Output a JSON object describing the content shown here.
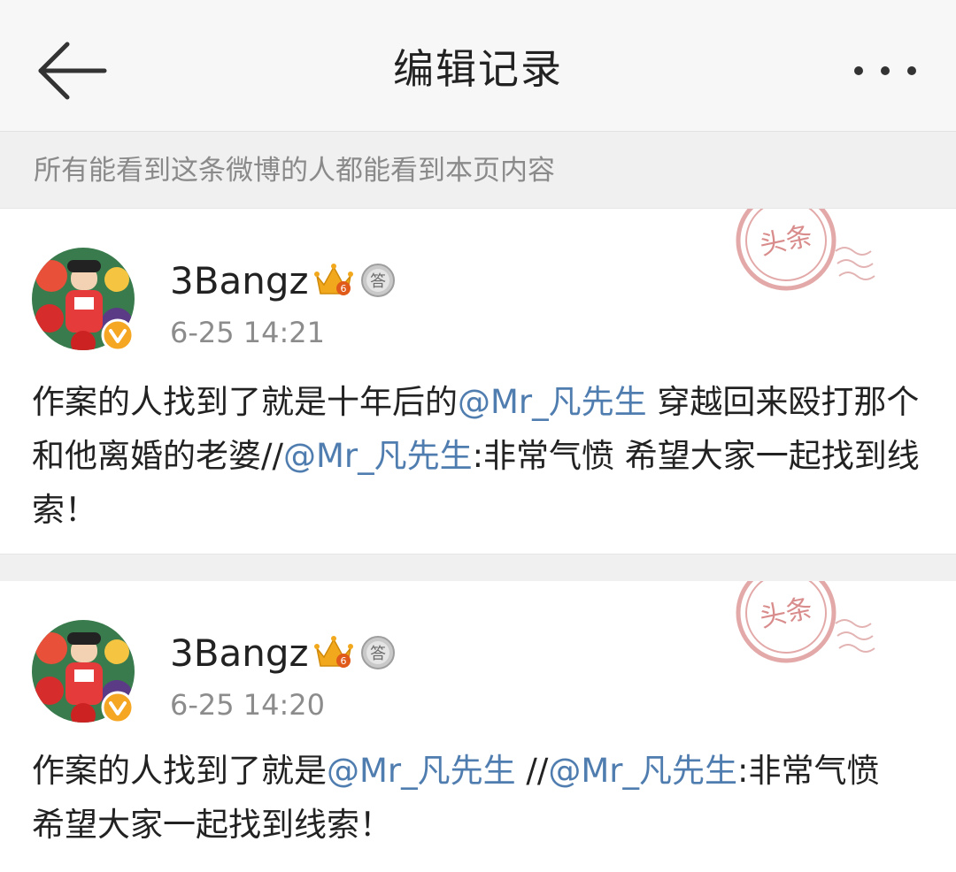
{
  "nav": {
    "title": "编辑记录",
    "back_icon": "arrow-left-icon",
    "more_icon": "more-dots-icon"
  },
  "notice": {
    "text": "所有能看到这条微博的人都能看到本页内容"
  },
  "posts": [
    {
      "username": "3Bangz",
      "timestamp": "6-25 14:21",
      "stamp_text": "头条",
      "segments": [
        {
          "type": "text",
          "text": "作案的人找到了就是十年后的"
        },
        {
          "type": "mention",
          "text": "@Mr_凡先生"
        },
        {
          "type": "text",
          "text": " 穿越回来殴打那个和他离婚的老婆//"
        },
        {
          "type": "mention",
          "text": "@Mr_凡先生"
        },
        {
          "type": "text",
          "text": ":非常气愤 希望大家一起找到线索！"
        }
      ]
    },
    {
      "username": "3Bangz",
      "timestamp": "6-25 14:20",
      "stamp_text": "头条",
      "segments": [
        {
          "type": "text",
          "text": "作案的人找到了就是"
        },
        {
          "type": "mention",
          "text": "@Mr_凡先生"
        },
        {
          "type": "text",
          "text": " //"
        },
        {
          "type": "mention",
          "text": "@Mr_凡先生"
        },
        {
          "type": "text",
          "text": ":非常气愤 希望大家一起找到线索！"
        }
      ]
    }
  ],
  "badges": {
    "crown_level": "6",
    "answer_label": "答"
  },
  "colors": {
    "mention": "#507daf",
    "verified": "#f5a623",
    "crown": "#f2a81d",
    "stamp": "#d97b7b"
  }
}
